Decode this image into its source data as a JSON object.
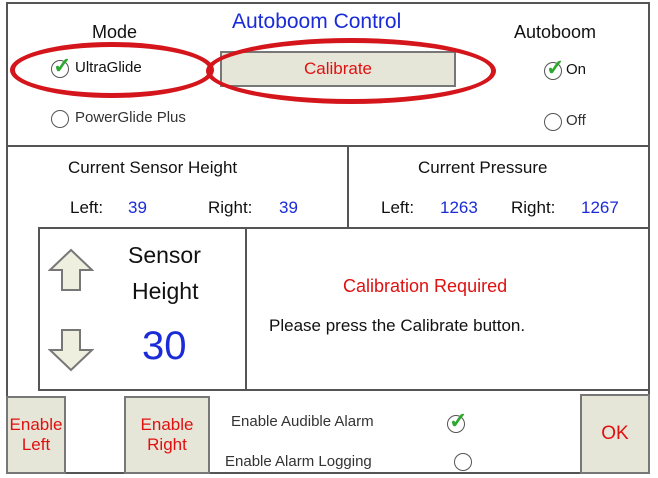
{
  "header": {
    "title": "Autoboom Control",
    "mode_label": "Mode",
    "autoboom_label": "Autoboom",
    "calibrate_label": "Calibrate"
  },
  "mode": {
    "options": [
      {
        "label": "UltraGlide",
        "selected": true
      },
      {
        "label": "PowerGlide Plus",
        "selected": false
      }
    ]
  },
  "autoboom": {
    "options": [
      {
        "label": "On",
        "selected": true
      },
      {
        "label": "Off",
        "selected": false
      }
    ]
  },
  "sensor_height": {
    "title": "Current Sensor Height",
    "left_label": "Left:",
    "left_value": "39",
    "right_label": "Right:",
    "right_value": "39"
  },
  "pressure": {
    "title": "Current Pressure",
    "left_label": "Left:",
    "left_value": "1263",
    "right_label": "Right:",
    "right_value": "1267"
  },
  "setpoint": {
    "label_line1": "Sensor",
    "label_line2": "Height",
    "value": "30"
  },
  "message": {
    "title": "Calibration Required",
    "body": "Please press the Calibrate button."
  },
  "footer": {
    "enable_left_1": "Enable",
    "enable_left_2": "Left",
    "enable_right_1": "Enable",
    "enable_right_2": "Right",
    "audible_alarm_label": "Enable Audible Alarm",
    "audible_alarm_checked": true,
    "alarm_logging_label": "Enable Alarm Logging",
    "alarm_logging_checked": false,
    "ok_label": "OK"
  },
  "colors": {
    "value_blue": "#1a2bd8",
    "alert_red": "#e01010",
    "annotation_red": "#d4161c",
    "check_green": "#2ea82e",
    "button_face": "#e6e6d8"
  }
}
